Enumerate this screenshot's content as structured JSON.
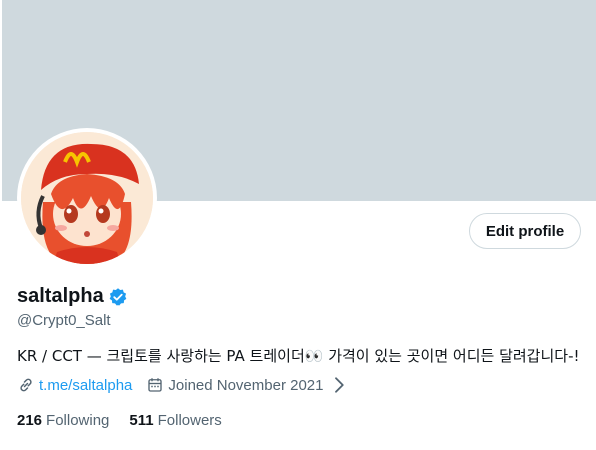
{
  "colors": {
    "banner": "#cfd9de",
    "accent": "#1d9bf0",
    "secondary_text": "#536471",
    "primary_text": "#0f1419",
    "verified": "#1d9bf0",
    "avatar_hat": "#d9321f",
    "avatar_logo": "#f7c300",
    "avatar_hair": "#e8502d"
  },
  "profile": {
    "edit_label": "Edit profile",
    "display_name": "saltalpha",
    "handle": "@Crypt0_Salt",
    "bio": "KR / CCT — 크립토를 사랑하는 PA 트레이더👀 가격이 있는 곳이면 어디든 달려갑니다-!",
    "website": "t.me/saltalpha",
    "joined": "Joined November 2021",
    "following_count": "216",
    "following_label": "Following",
    "followers_count": "511",
    "followers_label": "Followers"
  },
  "icons": {
    "verified": "verified-badge-icon",
    "link": "link-icon",
    "calendar": "calendar-icon",
    "chevron": "chevron-right-icon"
  }
}
